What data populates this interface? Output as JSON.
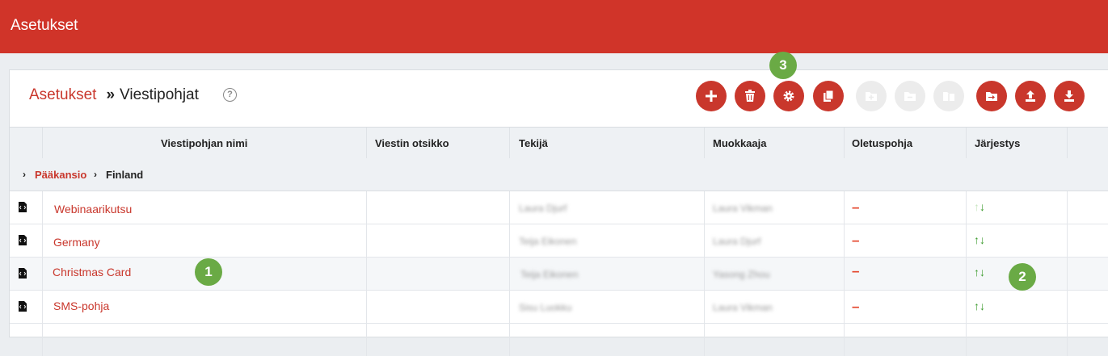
{
  "app": {
    "title": "Asetukset"
  },
  "breadcrumb": {
    "root": "Asetukset",
    "separator": "»",
    "current": "Viestipohjat",
    "help": "?"
  },
  "toolbar": {
    "buttons": [
      {
        "name": "add-button",
        "icon": "plus-icon",
        "enabled": true
      },
      {
        "name": "delete-button",
        "icon": "trash-icon",
        "enabled": true
      },
      {
        "name": "settings-button",
        "icon": "gear-icon",
        "enabled": true
      },
      {
        "name": "copy-button",
        "icon": "copy-icon",
        "enabled": true
      },
      {
        "name": "add-folder-button",
        "icon": "folder-plus-icon",
        "enabled": false
      },
      {
        "name": "remove-folder-button",
        "icon": "folder-minus-icon",
        "enabled": false
      },
      {
        "name": "folder-info-button",
        "icon": "folder-info-icon",
        "enabled": false
      },
      {
        "name": "move-button",
        "icon": "move-to-folder-icon",
        "enabled": true
      },
      {
        "name": "upload-button",
        "icon": "upload-icon",
        "enabled": true
      },
      {
        "name": "download-button",
        "icon": "download-icon",
        "enabled": true
      }
    ]
  },
  "table": {
    "columns": [
      "Viestipohjan nimi",
      "Viestin otsikko",
      "Tekijä",
      "Muokkaaja",
      "Oletuspohja",
      "Järjestys"
    ],
    "folder_path": {
      "root": "Pääkansio",
      "current": "Finland"
    },
    "rows": [
      {
        "name": "Webinaarikutsu",
        "subject": "",
        "author": "Laura Djurf",
        "editor": "Laura Vikman",
        "default": "–",
        "order_up": "↑",
        "order_down": "↓",
        "up_enabled": false
      },
      {
        "name": "Germany",
        "subject": "",
        "author": "Teija Eikonen",
        "editor": "Laura Djurf",
        "default": "–",
        "order_up": "↑",
        "order_down": "↓",
        "up_enabled": true
      },
      {
        "name": "Christmas Card",
        "subject": "",
        "author": "Teija Eikonen",
        "editor": "Yasong Zhou",
        "default": "–",
        "order_up": "↑",
        "order_down": "↓",
        "up_enabled": true
      },
      {
        "name": "SMS-pohja",
        "subject": "",
        "author": "Sisu Luokku",
        "editor": "Laura Vikman",
        "default": "–",
        "order_up": "↑",
        "order_down": "↓",
        "up_enabled": true
      }
    ]
  },
  "annotations": {
    "badge1": "1",
    "badge2": "2",
    "badge3": "3"
  },
  "colors": {
    "header_red": "#d03429",
    "accent_red": "#c9372c",
    "dash_orange": "#e4462b",
    "arrow_green": "#3a9a2b",
    "badge_green": "#6aaa45"
  }
}
